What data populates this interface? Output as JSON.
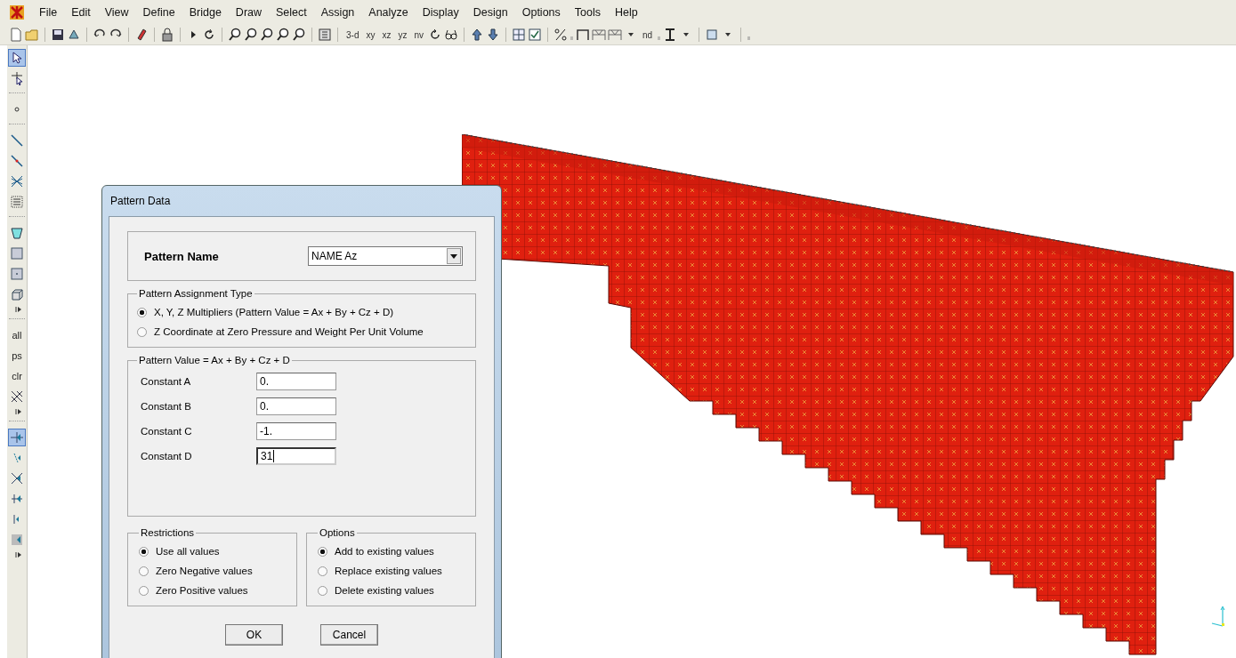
{
  "menu": [
    "File",
    "Edit",
    "View",
    "Define",
    "Bridge",
    "Draw",
    "Select",
    "Assign",
    "Analyze",
    "Display",
    "Design",
    "Options",
    "Tools",
    "Help"
  ],
  "toolbar": {
    "view_buttons": [
      "3-d",
      "xy",
      "xz",
      "yz",
      "nv"
    ],
    "nd_button": "nd"
  },
  "left_toolbar": {
    "items": [
      {
        "kind": "tool",
        "selected": true
      },
      {
        "kind": "tool",
        "selected": false
      },
      {
        "kind": "separator"
      },
      {
        "kind": "tool",
        "selected": false
      },
      {
        "kind": "separator"
      },
      {
        "kind": "tool",
        "selected": false
      },
      {
        "kind": "tool",
        "selected": false
      },
      {
        "kind": "tool",
        "selected": false
      },
      {
        "kind": "tool",
        "selected": false
      },
      {
        "kind": "separator"
      },
      {
        "kind": "tool",
        "selected": false
      },
      {
        "kind": "tool",
        "selected": false
      },
      {
        "kind": "tool",
        "selected": false
      },
      {
        "kind": "tool",
        "selected": false
      },
      {
        "kind": "more"
      },
      {
        "kind": "separator"
      },
      {
        "kind": "text",
        "label": "all",
        "selected": false
      },
      {
        "kind": "text",
        "label": "ps",
        "selected": false
      },
      {
        "kind": "text",
        "label": "clr",
        "selected": false
      },
      {
        "kind": "tool",
        "selected": false
      },
      {
        "kind": "more"
      },
      {
        "kind": "separator"
      },
      {
        "kind": "tool",
        "selected": true
      },
      {
        "kind": "tool",
        "selected": false
      },
      {
        "kind": "tool",
        "selected": false
      },
      {
        "kind": "tool",
        "selected": false
      },
      {
        "kind": "tool",
        "selected": false
      },
      {
        "kind": "tool",
        "selected": false
      },
      {
        "kind": "more"
      }
    ]
  },
  "dialog": {
    "title": "Pattern Data",
    "pattern_name": {
      "label": "Pattern Name",
      "value": "NAME Az"
    },
    "assignment_type": {
      "legend": "Pattern Assignment Type",
      "options": [
        {
          "label": "X, Y, Z Multipliers  (Pattern Value = Ax + By + Cz + D)",
          "selected": true
        },
        {
          "label": "Z Coordinate at Zero Pressure and Weight Per Unit Volume",
          "selected": false
        }
      ]
    },
    "pattern_value": {
      "legend": "Pattern Value =  Ax + By + Cz + D",
      "constants": [
        {
          "label": "Constant  A",
          "value": "0.",
          "focused": false
        },
        {
          "label": "Constant  B",
          "value": "0.",
          "focused": false
        },
        {
          "label": "Constant  C",
          "value": "-1.",
          "focused": false
        },
        {
          "label": "Constant  D",
          "value": "31",
          "focused": true
        }
      ]
    },
    "restrictions": {
      "legend": "Restrictions",
      "options": [
        {
          "label": "Use all values",
          "selected": true
        },
        {
          "label": "Zero Negative values",
          "selected": false
        },
        {
          "label": "Zero Positive values",
          "selected": false
        }
      ]
    },
    "options": {
      "legend": "Options",
      "options": [
        {
          "label": "Add to existing values",
          "selected": true
        },
        {
          "label": "Replace existing values",
          "selected": false
        },
        {
          "label": "Delete existing values",
          "selected": false
        }
      ]
    },
    "buttons": [
      "OK",
      "Cancel"
    ]
  }
}
